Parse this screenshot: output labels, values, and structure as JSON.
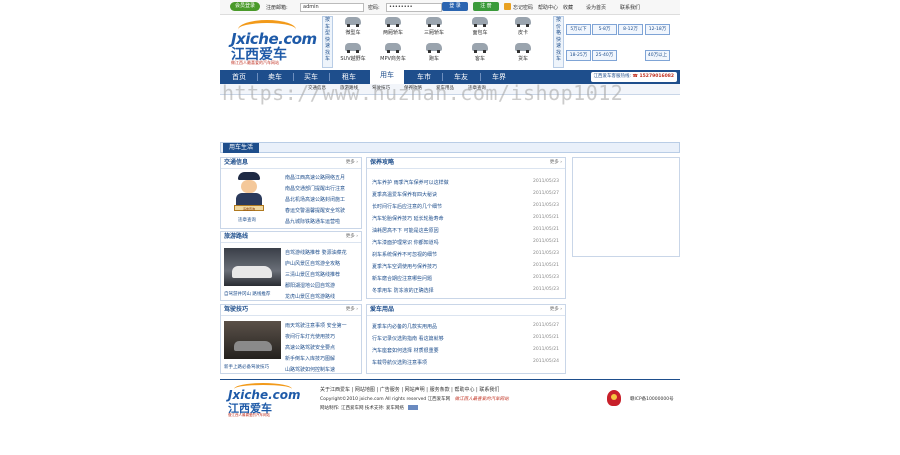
{
  "topbar": {
    "member_label": "会员登录",
    "username_label": "注册邮箱:",
    "username_value": "admin",
    "password_label": "密码:",
    "password_value": "••••••••",
    "login_label": "登 录",
    "register_label": "注 册",
    "links": [
      "忘记密码",
      "帮助中心",
      "收藏",
      "设为首页",
      "联系我们"
    ]
  },
  "logo": {
    "en": "Jxiche.com",
    "cn": "江西爱车",
    "slogan": "做江西人最喜爱的汽车网站"
  },
  "vehicle_type": {
    "label": "按车型快速找车",
    "items": [
      "微型车",
      "两厢轿车",
      "三厢轿车",
      "面包车",
      "皮卡",
      "SUV越野车",
      "MPV商务车",
      "跑车",
      "客车",
      "货车"
    ]
  },
  "price": {
    "label": "按价格快速找车",
    "items": [
      "5万以下",
      "5-8万",
      "8-12万",
      "12-18万",
      "18-25万",
      "25-40万",
      "40万以上"
    ]
  },
  "nav": {
    "items": [
      "首页",
      "卖车",
      "买车",
      "租车",
      "用车",
      "车市",
      "车友",
      "车界"
    ],
    "hotline_label": "江西爱车客服热线:",
    "hotline_value": "15279016082"
  },
  "subnav": {
    "items": [
      "交通信息",
      "旅游路线",
      "驾驶技巧",
      "保养攻略",
      "爱车用品",
      "违章查询"
    ]
  },
  "watermark": "https://www.huzhan.com/ishop1012",
  "section": {
    "title": "用车生活"
  },
  "traffic": {
    "title": "交通信息",
    "more": "更多",
    "police_caption": "违章查询",
    "items": [
      "南昌江西高速公路网络五月",
      "南昌交通部门提醒出行注意",
      "昌北机场高速公路封闭施工",
      "春运交警温馨提醒安全驾驶",
      "昌九城际铁路通车运营啦"
    ]
  },
  "maintenance": {
    "title": "保养攻略",
    "more": "更多",
    "items": [
      {
        "text": "汽车养护 雨季汽车保养可以这样做",
        "date": "2011/05/23"
      },
      {
        "text": "夏季高温爱车保养有四大秘诀",
        "date": "2011/05/27"
      },
      {
        "text": "长时间行车后应注意的几个细节",
        "date": "2011/05/23"
      },
      {
        "text": "汽车轮胎保养技巧 延长轮胎寿命",
        "date": "2011/05/21"
      },
      {
        "text": "油耗居高不下 可能是这些原因",
        "date": "2011/05/21"
      },
      {
        "text": "汽车漆面护理常识 你都知道吗",
        "date": "2011/05/21"
      },
      {
        "text": "刹车系统保养不可忽视的细节",
        "date": "2011/05/23"
      },
      {
        "text": "夏季汽车空调使用与保养技巧",
        "date": "2011/05/21"
      },
      {
        "text": "新车磨合期应注意哪些问题",
        "date": "2011/05/23"
      },
      {
        "text": "冬季用车 防冻液的正确选择",
        "date": "2011/05/23"
      }
    ]
  },
  "travel": {
    "title": "旅游路线",
    "more": "更多",
    "caption": "自驾游井冈山 路线推荐",
    "items": [
      "自驾游线路推荐 婺源油菜花",
      "庐山风景区自驾游全攻略",
      "三清山景区自驾路线推荐",
      "鄱阳湖湿地公园自驾游",
      "龙虎山景区自驾游路线"
    ]
  },
  "driving": {
    "title": "驾驶技巧",
    "more": "更多",
    "caption": "新手上路必备驾驶技巧",
    "items": [
      "雨天驾驶注意事项 安全第一",
      "夜间行车灯光使用技巧",
      "高速公路驾驶安全要点",
      "新手倒车入库技巧图解",
      "山路驾驶如何控制车速"
    ]
  },
  "accessories": {
    "title": "爱车用品",
    "more": "更多",
    "items": [
      {
        "text": "夏季车内必备的几款实用用品",
        "date": "2011/05/27"
      },
      {
        "text": "行车记录仪选购指南 看这篇就够",
        "date": "2011/05/21"
      },
      {
        "text": "汽车座套如何选择 材质很重要",
        "date": "2011/05/21"
      },
      {
        "text": "车载导航仪选购注意事项",
        "date": "2011/05/24"
      }
    ]
  },
  "footer": {
    "links": [
      "关于江西爱车",
      "网站地图",
      "广告服务",
      "网站声明",
      "服务条款",
      "帮助中心",
      "联系我们"
    ],
    "copyright": "Copyright©2010 jxiche.com All rights reserved 江西爱车网",
    "slogan": "做江西人最喜爱的汽车网站",
    "tech": "网站制作: 江西爱车网 技术支持: 爱车网络",
    "icp": "赣ICP备10000000号"
  },
  "colors": {
    "brand": "#1e4e8c",
    "accent": "#f29a1a",
    "red": "#c03020"
  }
}
